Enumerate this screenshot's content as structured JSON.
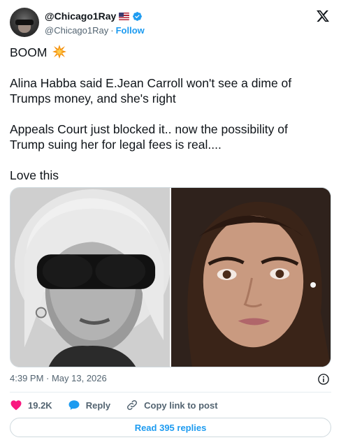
{
  "author": {
    "display_name": "@Chicago1Ray",
    "handle": "@Chicago1Ray",
    "separator": "·",
    "follow_label": "Follow",
    "flag_icon": "us-flag-icon",
    "verified_icon": "verified-badge-icon"
  },
  "brand": {
    "logo": "x-logo-icon"
  },
  "tweet": {
    "paragraphs": [
      {
        "text": "BOOM",
        "emoji": "collision-emoji"
      },
      {
        "lines": [
          "Alina Habba said E.Jean Carroll won't see a dime of",
          "Trumps money, and she's right"
        ]
      },
      {
        "lines": [
          "Appeals Court just blocked it.. now the possibility of",
          "Trump suing her for legal fees is real...."
        ]
      },
      {
        "lines": [
          "Love this"
        ]
      }
    ]
  },
  "media": {
    "photos": [
      {
        "description": "black-and-white photo of a woman with grey hair and dark sunglasses"
      },
      {
        "description": "color photo of a woman with dark hair"
      }
    ]
  },
  "meta": {
    "timestamp": "4:39 PM · May 13, 2026"
  },
  "actions": {
    "like_count": "19.2K",
    "reply_label": "Reply",
    "copy_label": "Copy link to post",
    "read_replies_label": "Read 395 replies"
  },
  "colors": {
    "accent": "#1d9bf0",
    "like": "#f91880",
    "text": "#0f1419",
    "muted": "#536471",
    "border": "#cfd9de"
  }
}
